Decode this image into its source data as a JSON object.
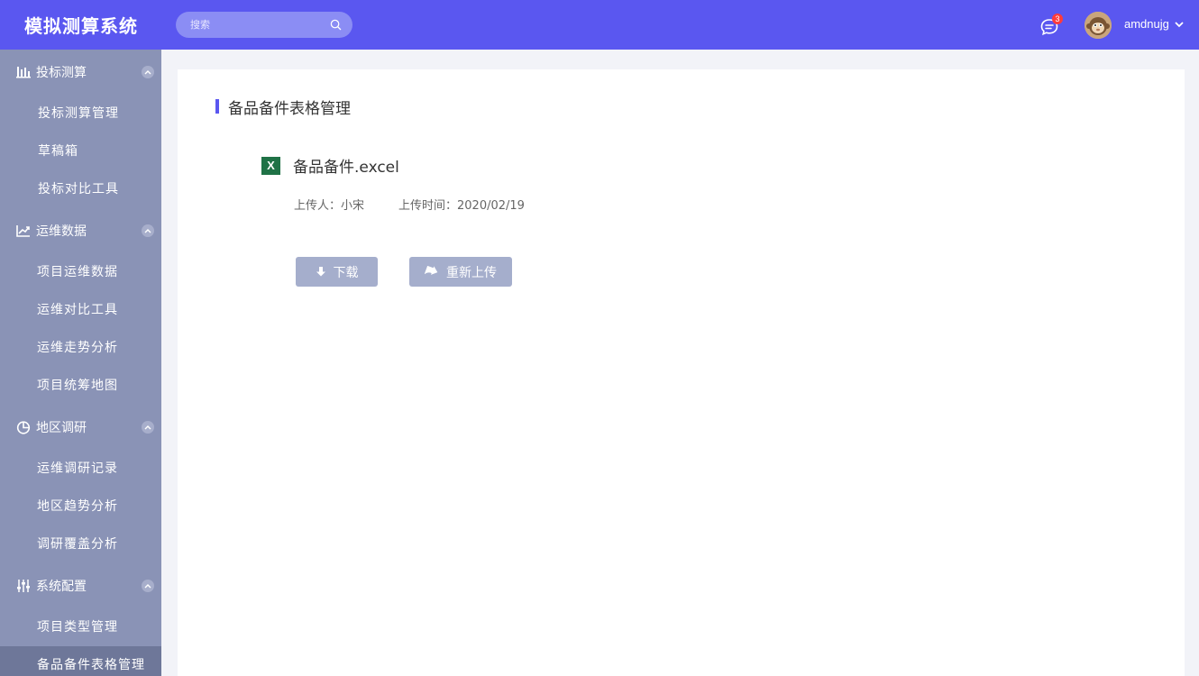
{
  "header": {
    "app_title": "模拟测算系统",
    "search_placeholder": "搜索",
    "message_count": "3",
    "username": "amdnujg"
  },
  "sidebar": {
    "groups": [
      {
        "label": "投标测算",
        "icon": "bar-chart-icon",
        "items": [
          "投标测算管理",
          "草稿箱",
          "投标对比工具"
        ]
      },
      {
        "label": "运维数据",
        "icon": "line-chart-icon",
        "items": [
          "项目运维数据",
          "运维对比工具",
          "运维走势分析",
          "项目统筹地图"
        ]
      },
      {
        "label": "地区调研",
        "icon": "pie-chart-icon",
        "items": [
          "运维调研记录",
          "地区趋势分析",
          "调研覆盖分析"
        ]
      },
      {
        "label": "系统配置",
        "icon": "sliders-icon",
        "items": [
          "项目类型管理",
          "备品备件表格管理"
        ]
      }
    ]
  },
  "main": {
    "page_title": "备品备件表格管理",
    "file_name": "备品备件.excel",
    "excel_letter": "X",
    "uploader": "上传人：小宋",
    "upload_time": "上传时间：2020/02/19",
    "download_label": "下载",
    "reupload_label": "重新上传"
  },
  "colors": {
    "header_bg": "#5a57f0",
    "sidebar_bg": "#8a93b6",
    "sidebar_active": "#6e7799",
    "button_bg": "#a5aecc",
    "excel_green": "#1f7246"
  }
}
